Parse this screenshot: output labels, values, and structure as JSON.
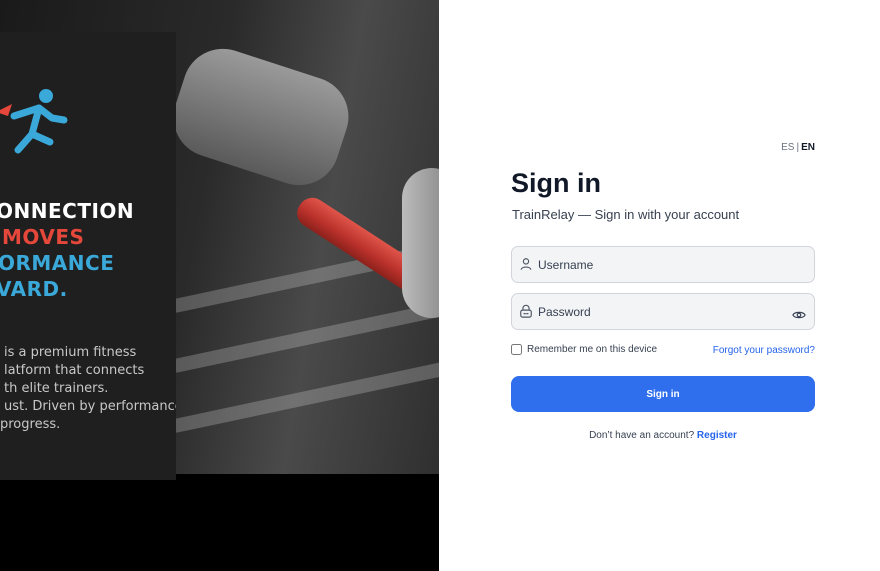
{
  "hero": {
    "headline": [
      "ONNECTION",
      "MOVES",
      "ORMANCE",
      "VARD."
    ],
    "description": [
      "is a premium fitness",
      "latform that connects",
      "th elite trainers.",
      "ust. Driven by performance.",
      "progress."
    ]
  },
  "lang": {
    "es": "ES",
    "sep": "|",
    "en": "EN"
  },
  "form": {
    "title": "Sign in",
    "subtitle": "TrainRelay — Sign in with your account",
    "username_placeholder": "Username",
    "password_placeholder": "Password",
    "remember_label": "Remember me on this device",
    "forgot_label": "Forgot your password?",
    "submit_label": "Sign in",
    "no_account": "Don’t have an account?",
    "register_label": "Register"
  },
  "colors": {
    "primary": "#2f6fed",
    "link": "#2563eb",
    "hero_red": "#e5483b",
    "hero_blue": "#3aa8d8"
  },
  "icons": {
    "username": "user-icon",
    "password": "lock-icon",
    "toggle": "eye-icon",
    "logo": "runner-logo-icon"
  }
}
